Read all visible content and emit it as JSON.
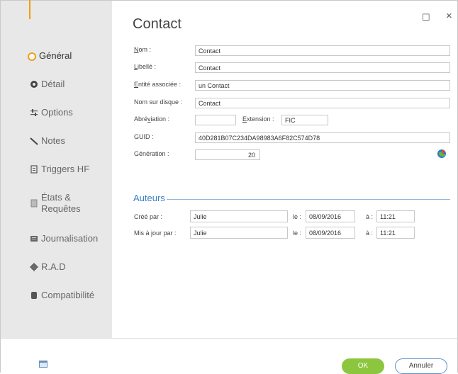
{
  "title": "Contact",
  "window_controls": {
    "maximize": "☐",
    "close": "×"
  },
  "sidebar": {
    "items": [
      {
        "label": "Général",
        "icon": "general-icon",
        "active": true
      },
      {
        "label": "Détail",
        "icon": "detail-icon"
      },
      {
        "label": "Options",
        "icon": "options-icon"
      },
      {
        "label": "Notes",
        "icon": "notes-icon"
      },
      {
        "label": "Triggers HF",
        "icon": "triggers-icon"
      },
      {
        "label": "États &",
        "label2": "Requêtes",
        "icon": "reports-icon"
      },
      {
        "label": "Journalisation",
        "icon": "journal-icon"
      },
      {
        "label": "R.A.D",
        "icon": "rad-icon"
      },
      {
        "label": "Compatibilité",
        "icon": "compat-icon"
      }
    ]
  },
  "form": {
    "nom": {
      "label_ul": "N",
      "label_rest": "om :",
      "value": "Contact"
    },
    "libelle": {
      "label_ul": "L",
      "label_rest": "ibellé :",
      "value": "Contact"
    },
    "entite": {
      "label_ul": "E",
      "label_rest": "ntité associée :",
      "value": "un Contact"
    },
    "disque": {
      "label": "Nom sur disque :",
      "value": "Contact"
    },
    "abreviation": {
      "label_pre": "Abré",
      "label_ul": "v",
      "label_rest": "iation :",
      "value": ""
    },
    "extension": {
      "label_ul": "E",
      "label_rest": "xtension :",
      "value": "FIC"
    },
    "guid": {
      "label": "GUID :",
      "value": "40D281B07C234DA98983A6F82C574D78"
    },
    "generation": {
      "label": "Génération :",
      "value": "20"
    }
  },
  "auteurs": {
    "section_title": "Auteurs",
    "cree": {
      "label": "Créé par :",
      "user": "Julie",
      "le_label": "le :",
      "date": "08/09/2016",
      "a_label": "à :",
      "time": "11:21"
    },
    "maj": {
      "label": "Mis à jour par :",
      "user": "Julie",
      "le_label": "le :",
      "date": "08/09/2016",
      "a_label": "à :",
      "time": "11:21"
    }
  },
  "buttons": {
    "ok": "OK",
    "cancel": "Annuler"
  },
  "colors": {
    "accent": "#f39c12",
    "ok": "#8cc63f",
    "section": "#3b7fc4"
  }
}
